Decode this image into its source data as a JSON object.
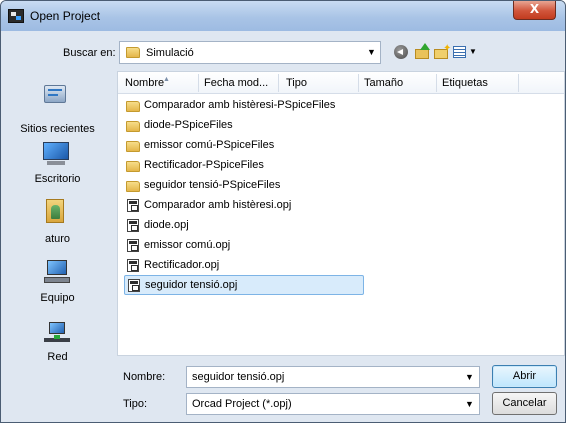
{
  "window": {
    "title": "Open Project",
    "close_label": "X"
  },
  "lookin": {
    "label": "Buscar en:",
    "value": "Simulació"
  },
  "toolbar": {
    "icons": [
      "back-icon",
      "up-folder-icon",
      "new-folder-icon",
      "views-menu-icon"
    ]
  },
  "places": [
    {
      "label": "Sitios recientes",
      "icon": "recent-places-icon"
    },
    {
      "label": "Escritorio",
      "icon": "desktop-icon"
    },
    {
      "label": "aturo",
      "icon": "user-folder-icon"
    },
    {
      "label": "Equipo",
      "icon": "computer-icon"
    },
    {
      "label": "Red",
      "icon": "network-icon"
    }
  ],
  "columns": [
    "Nombre",
    "Fecha mod...",
    "Tipo",
    "Tamaño",
    "Etiquetas"
  ],
  "files": [
    {
      "name": "Comparador amb histèresi-PSpiceFiles",
      "kind": "folder"
    },
    {
      "name": "diode-PSpiceFiles",
      "kind": "folder"
    },
    {
      "name": "emissor comú-PSpiceFiles",
      "kind": "folder"
    },
    {
      "name": "Rectificador-PSpiceFiles",
      "kind": "folder"
    },
    {
      "name": "seguidor tensió-PSpiceFiles",
      "kind": "folder"
    },
    {
      "name": "Comparador amb histèresi.opj",
      "kind": "opj"
    },
    {
      "name": "diode.opj",
      "kind": "opj"
    },
    {
      "name": "emissor comú.opj",
      "kind": "opj"
    },
    {
      "name": "Rectificador.opj",
      "kind": "opj"
    },
    {
      "name": "seguidor tensió.opj",
      "kind": "opj",
      "selected": true
    }
  ],
  "filename": {
    "label": "Nombre:",
    "value": "seguidor tensió.opj"
  },
  "filetype": {
    "label": "Tipo:",
    "value": "Orcad Project (*.opj)"
  },
  "buttons": {
    "open": "Abrir",
    "cancel": "Cancelar"
  }
}
